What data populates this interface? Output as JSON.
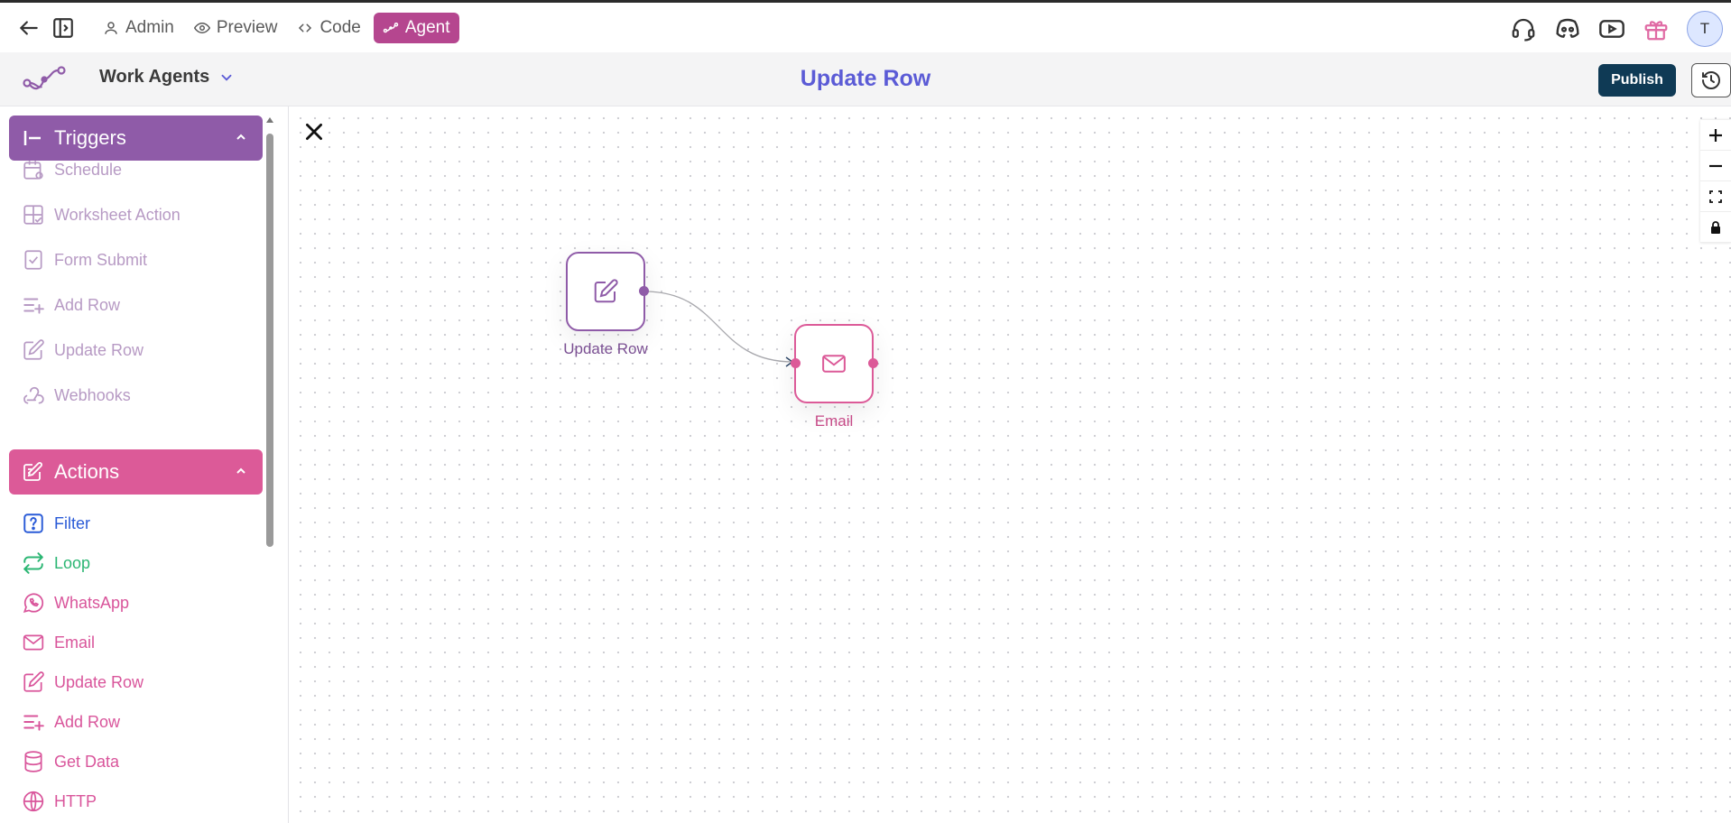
{
  "topbar": {
    "nav": [
      {
        "label": "Admin",
        "icon": "user-icon"
      },
      {
        "label": "Preview",
        "icon": "eye-icon"
      },
      {
        "label": "Code",
        "icon": "code-icon"
      },
      {
        "label": "Agent",
        "icon": "agent-flow-icon",
        "active": true
      }
    ],
    "right_icons": [
      "headset-icon",
      "discord-icon",
      "youtube-icon",
      "gift-icon"
    ],
    "avatar_initial": "T"
  },
  "subheader": {
    "workspace": "Work Agents",
    "title": "Update Row",
    "publish_label": "Publish"
  },
  "sidebar": {
    "triggers": {
      "title": "Triggers",
      "items": [
        {
          "label": "Schedule",
          "icon": "calendar-gear-icon"
        },
        {
          "label": "Worksheet Action",
          "icon": "worksheet-check-icon"
        },
        {
          "label": "Form Submit",
          "icon": "form-check-icon"
        },
        {
          "label": "Add Row",
          "icon": "add-row-icon"
        },
        {
          "label": "Update Row",
          "icon": "edit-icon"
        },
        {
          "label": "Webhooks",
          "icon": "webhook-icon"
        }
      ]
    },
    "actions": {
      "title": "Actions",
      "items": [
        {
          "label": "Filter",
          "icon": "question-icon"
        },
        {
          "label": "Loop",
          "icon": "loop-icon"
        },
        {
          "label": "WhatsApp",
          "icon": "whatsapp-icon"
        },
        {
          "label": "Email",
          "icon": "mail-icon"
        },
        {
          "label": "Update Row",
          "icon": "edit-icon"
        },
        {
          "label": "Add Row",
          "icon": "add-row-icon"
        },
        {
          "label": "Get Data",
          "icon": "database-icon"
        },
        {
          "label": "HTTP",
          "icon": "globe-icon"
        }
      ]
    }
  },
  "canvas": {
    "nodes": [
      {
        "label": "Update Row",
        "icon": "edit-icon"
      },
      {
        "label": "Email",
        "icon": "mail-icon"
      }
    ]
  },
  "colors": {
    "trigger": "#8f5ba8",
    "action": "#dc5a98",
    "title": "#5b5bd6",
    "publish": "#0f3a55",
    "agent_tab": "#b5468f",
    "filter": "#2a5bd7",
    "loop": "#2bb673"
  }
}
